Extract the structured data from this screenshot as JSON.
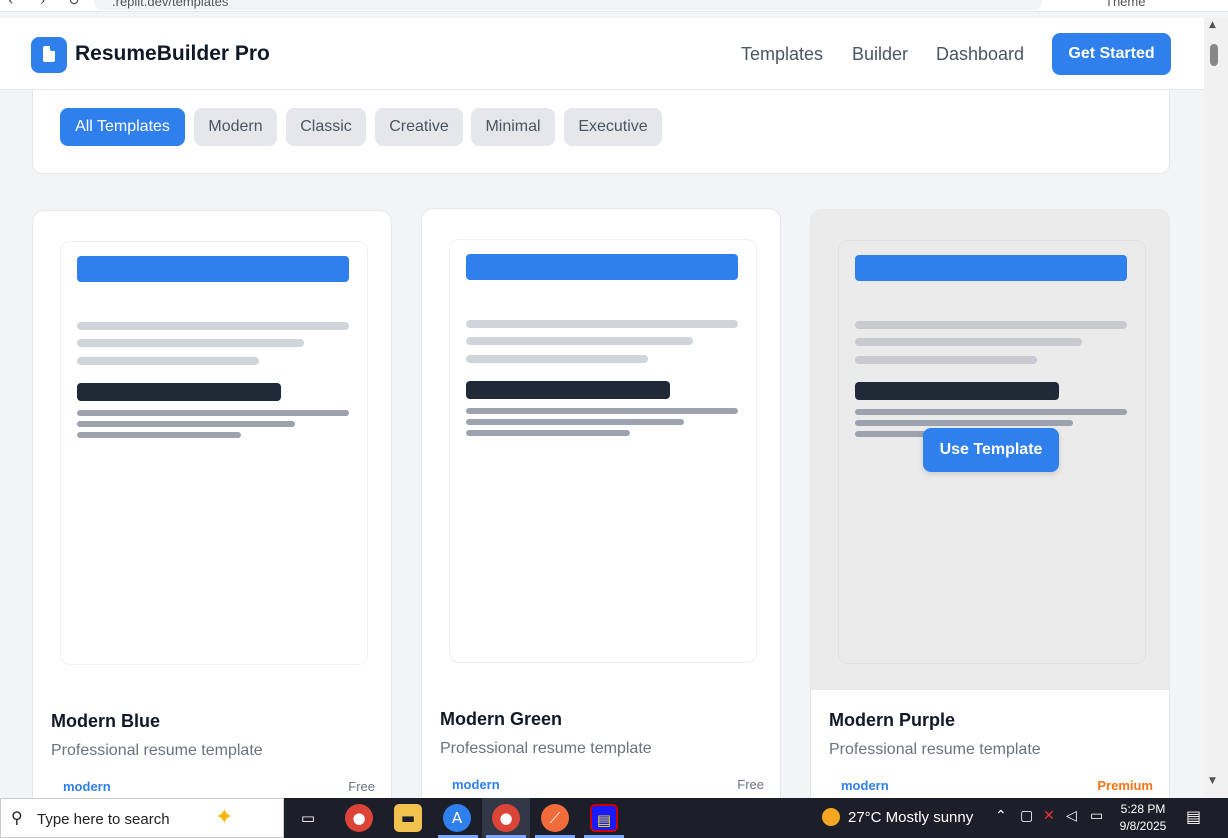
{
  "browser": {
    "url": ".replit.dev/templates",
    "theme_label": "Theme"
  },
  "header": {
    "brand": "ResumeBuilder Pro",
    "nav": [
      "Templates",
      "Builder",
      "Dashboard"
    ],
    "cta": "Get Started"
  },
  "filters": {
    "chips": [
      "All Templates",
      "Modern",
      "Classic",
      "Creative",
      "Minimal",
      "Executive"
    ],
    "active": "All Templates"
  },
  "cards": [
    {
      "title": "Modern Blue",
      "description": "Professional resume template",
      "tag": "modern",
      "price": "Free",
      "hovered": false
    },
    {
      "title": "Modern Green",
      "description": "Professional resume template",
      "tag": "modern",
      "price": "Free",
      "hovered": false
    },
    {
      "title": "Modern Purple",
      "description": "Professional resume template",
      "tag": "modern",
      "price": "Premium",
      "hovered": true,
      "hover_button": "Use Template"
    }
  ],
  "colors": {
    "primary": "#2f80ed",
    "premium": "#f97316",
    "dark_bar": "#1f2937"
  },
  "taskbar": {
    "search_placeholder": "Type here to search",
    "weather": "27°C  Mostly sunny",
    "time": "5:28 PM",
    "date": "9/8/2025",
    "apps": [
      "task-view-icon",
      "chrome-icon",
      "file-explorer-icon",
      "app-a-icon",
      "chrome-profile-icon",
      "compass-icon",
      "notes-icon"
    ]
  }
}
